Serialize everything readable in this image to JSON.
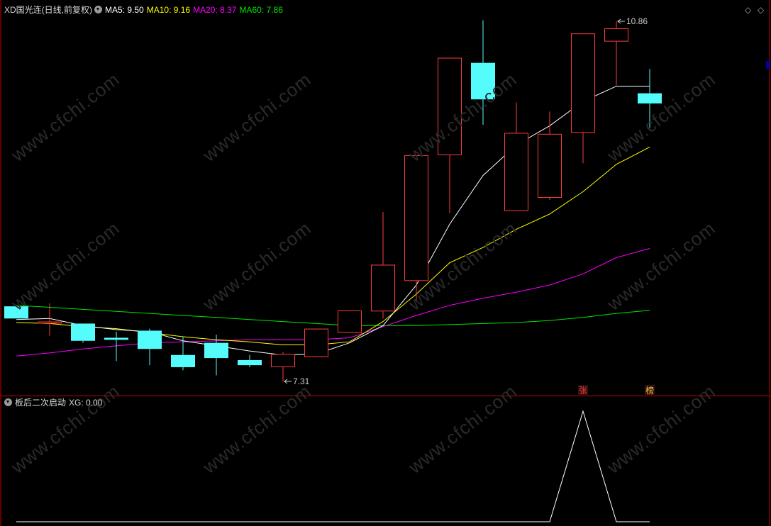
{
  "header": {
    "title": "XD国光连(日线,前复权)",
    "ma5_label": "MA5:",
    "ma5_value": "9.50",
    "ma10_label": "MA10:",
    "ma10_value": "9.16",
    "ma20_label": "MA20:",
    "ma20_value": "8.37",
    "ma60_label": "MA60:",
    "ma60_value": "7.86"
  },
  "indicator": {
    "title": "板后二次启动",
    "xg_label": "XG:",
    "xg_value": "0.00"
  },
  "watermark": "www.cfchi.com",
  "colors": {
    "up": "#ff3c3c",
    "down": "#54fcfc",
    "ma5": "#ffffff",
    "ma10": "#ffff00",
    "ma20": "#ff00ff",
    "ma60": "#00e600",
    "axis_red": "#c80000",
    "title": "#d8d8d8"
  },
  "chart_data": {
    "type": "candlestick",
    "candles": [
      {
        "open": 8.05,
        "close": 7.93,
        "high": 8.05,
        "low": 7.93
      },
      {
        "open": 7.88,
        "close": 7.9,
        "high": 8.08,
        "low": 7.76
      },
      {
        "open": 7.88,
        "close": 7.71,
        "high": 7.88,
        "low": 7.69
      },
      {
        "open": 7.74,
        "close": 7.72,
        "high": 7.8,
        "low": 7.51
      },
      {
        "open": 7.81,
        "close": 7.63,
        "high": 7.83,
        "low": 7.47
      },
      {
        "open": 7.57,
        "close": 7.45,
        "high": 7.75,
        "low": 7.42
      },
      {
        "open": 7.69,
        "close": 7.54,
        "high": 7.77,
        "low": 7.37
      },
      {
        "open": 7.52,
        "close": 7.47,
        "high": 7.57,
        "low": 7.45
      },
      {
        "open": 7.45,
        "close": 7.58,
        "high": 7.6,
        "low": 7.31
      },
      {
        "open": 7.55,
        "close": 7.83,
        "high": 7.83,
        "low": 7.55
      },
      {
        "open": 7.79,
        "close": 8.01,
        "high": 8.01,
        "low": 7.79
      },
      {
        "open": 8.0,
        "close": 8.46,
        "high": 8.98,
        "low": 7.93
      },
      {
        "open": 8.3,
        "close": 9.54,
        "high": 9.54,
        "low": 8.1
      },
      {
        "open": 9.54,
        "close": 10.5,
        "high": 10.5,
        "low": 8.97
      },
      {
        "open": 10.45,
        "close": 10.09,
        "high": 10.87,
        "low": 9.84
      },
      {
        "open": 8.99,
        "close": 9.76,
        "high": 10.06,
        "low": 8.99
      },
      {
        "open": 9.12,
        "close": 9.75,
        "high": 9.97,
        "low": 9.1
      },
      {
        "open": 9.76,
        "close": 10.74,
        "high": 10.74,
        "low": 9.46
      },
      {
        "open": 10.66,
        "close": 10.79,
        "high": 10.86,
        "low": 10.23
      },
      {
        "open": 10.15,
        "close": 10.05,
        "high": 10.39,
        "low": 9.81
      }
    ],
    "ma5": [
      7.92,
      7.93,
      7.86,
      7.82,
      7.8,
      7.71,
      7.66,
      7.61,
      7.57,
      7.58,
      7.69,
      7.86,
      8.26,
      8.86,
      9.34,
      9.64,
      9.83,
      10.07,
      10.22,
      10.22
    ],
    "ma10": [
      7.89,
      7.88,
      7.85,
      7.83,
      7.79,
      7.75,
      7.72,
      7.7,
      7.67,
      7.67,
      7.7,
      7.9,
      8.17,
      8.48,
      8.63,
      8.81,
      8.96,
      9.18,
      9.45,
      9.62
    ],
    "ma20": [
      7.56,
      7.59,
      7.63,
      7.66,
      7.69,
      7.7,
      7.71,
      7.72,
      7.72,
      7.72,
      7.74,
      7.85,
      7.96,
      8.06,
      8.13,
      8.19,
      8.26,
      8.37,
      8.53,
      8.62
    ],
    "ma60": [
      8.06,
      8.04,
      8.02,
      8.0,
      7.98,
      7.96,
      7.94,
      7.92,
      7.9,
      7.88,
      7.86,
      7.86,
      7.86,
      7.87,
      7.88,
      7.89,
      7.91,
      7.94,
      7.98,
      8.01
    ],
    "annotations": [
      {
        "text": "7.31",
        "index": 8,
        "price": 7.31
      },
      {
        "text": "10.86",
        "index": 18,
        "price": 10.86
      }
    ],
    "markers": [
      {
        "text": "张",
        "index": 17,
        "color": "#ff3c3c"
      },
      {
        "text": "榜",
        "index": 19,
        "color": "#ffc040"
      }
    ],
    "ylim": [
      7.31,
      10.86
    ],
    "xg": [
      0,
      0,
      0,
      0,
      0,
      0,
      0,
      0,
      0,
      0,
      0,
      0,
      0,
      0,
      0,
      0,
      0,
      1,
      0,
      0
    ]
  }
}
